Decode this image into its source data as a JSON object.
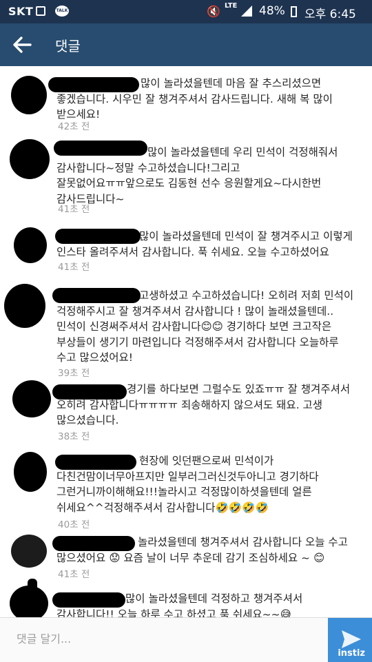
{
  "status_bar": {
    "carrier": "SKT",
    "network": "LTE",
    "battery": "48%",
    "time": "오후 6:45",
    "kakao_label": "TALK"
  },
  "header": {
    "title": "댓글"
  },
  "comments": [
    {
      "text": "많이 놀라셨을텐데 마음 잘 추스리셨으면\n좋겠습니다. 시우민 잘 챙겨주셔서 감사드립니다. 새해 복 많이\n받으세요!",
      "time": "42초 전"
    },
    {
      "text": "많이 놀라셨을텐데 우리 민석이 걱정해줘서\n감사합니다~정말 수고하셨습니다!그리고\n잘못없어요ㅠㅠ앞으로도 김동현 선수 응원할게요~다시한번\n감사드립니다~",
      "time": "41초 전"
    },
    {
      "text": "많이 놀라셨을텐데 민석이 잘 챙겨주시고 이렇게\n인스타 올려주셔서 감사합니다. 푹 쉬세요. 오늘 수고하셨어요",
      "time": "41초 전"
    },
    {
      "text": "고생하셨고 수고하셨습니다! 오히려 저희 민석이\n걱정해주시고 잘 챙겨주셔서 감사합니다 ! 많이 놀래셨을텐데..\n민석이 신경써주셔서 감사합니다😊😊 경기하다 보면 크고작은\n부상들이 생기기 마련입니다 걱정해주셔서 감사합니다 오늘하루\n수고 많으셨어요!",
      "time": "39초 전"
    },
    {
      "text": "경기를 하다보면 그럴수도 있죠ㅠㅠ 잘 챙겨주셔서\n오히려 감사합니다ㅠㅠㅠㅠ 죄송해하지 않으셔도 돼요. 고생\n많으셨습니다.",
      "time": "38초 전"
    },
    {
      "text": "현장에 잇던팬으로써 민석이가\n다친건맘이너무아프지만 일부러그러신것두아니고 경기하다\n그런거니까이해해요!!!놀라시고 걱정많이하셧을텐데 얼른\n쉬세요^^걱정해주셔서 감사합니다🤣🤣🤣🤣",
      "time": "40초 전"
    },
    {
      "text": "놀라셨을텐데 챙겨주셔서 감사합니다 오늘 수고\n많으셨어요 😟 요즘 날이 너무 추운데 감기 조심하세요 ~ 😊",
      "time": "41초 전"
    },
    {
      "text": "많이 놀라셨을텐데 걱정하고 챙겨주셔서\n감사합니다!! 오늘 하루 수고 하셨고 푹 쉬세요~~😅",
      "time": ""
    }
  ],
  "input": {
    "placeholder": "댓글 달기..."
  },
  "watermark": "instiz"
}
